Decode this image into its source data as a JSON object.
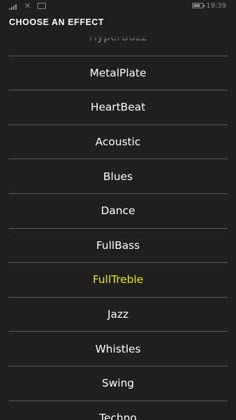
{
  "status_bar": {
    "time": "19:39",
    "signal_icon": "signal-bars-icon",
    "notification_icon": "x-icon",
    "message_icon": "message-icon",
    "battery_icon": "battery-icon"
  },
  "header": {
    "title": "CHOOSE AN EFFECT"
  },
  "effects": {
    "selected_color": "#e8e814",
    "items": [
      {
        "label": "HyperBuzz",
        "selected": false
      },
      {
        "label": "MetalPlate",
        "selected": false
      },
      {
        "label": "HeartBeat",
        "selected": false
      },
      {
        "label": "Acoustic",
        "selected": false
      },
      {
        "label": "Blues",
        "selected": false
      },
      {
        "label": "Dance",
        "selected": false
      },
      {
        "label": "FullBass",
        "selected": false
      },
      {
        "label": "FullTreble",
        "selected": true
      },
      {
        "label": "Jazz",
        "selected": false
      },
      {
        "label": "Whistles",
        "selected": false
      },
      {
        "label": "Swing",
        "selected": false
      },
      {
        "label": "Techno",
        "selected": false
      }
    ]
  }
}
